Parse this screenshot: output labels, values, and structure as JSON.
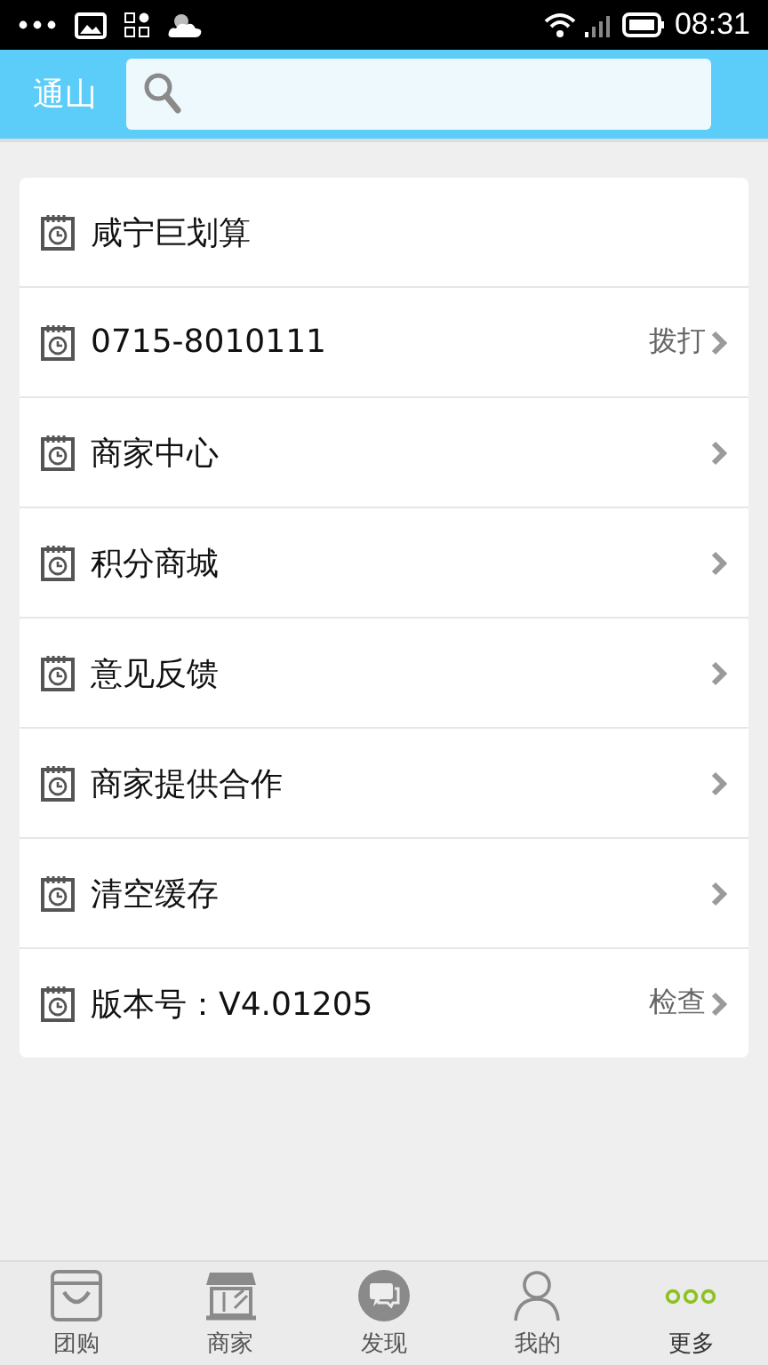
{
  "status_bar": {
    "time": "08:31"
  },
  "header": {
    "city": "通山"
  },
  "menu": [
    {
      "label": "咸宁巨划算",
      "chevron": false
    },
    {
      "label": "0715-8010111",
      "action": "拨打",
      "chevron": true
    },
    {
      "label": "商家中心",
      "chevron": true
    },
    {
      "label": "积分商城",
      "chevron": true
    },
    {
      "label": "意见反馈",
      "chevron": true
    },
    {
      "label": "商家提供合作",
      "chevron": true
    },
    {
      "label": "清空缓存",
      "chevron": true
    },
    {
      "label": "版本号：V4.01205",
      "action": "检查",
      "chevron": true
    }
  ],
  "tabs": [
    {
      "label": "团购",
      "kind": "bag",
      "selected": false
    },
    {
      "label": "商家",
      "kind": "shop",
      "selected": false
    },
    {
      "label": "发现",
      "kind": "chat",
      "selected": false
    },
    {
      "label": "我的",
      "kind": "person",
      "selected": false
    },
    {
      "label": "更多",
      "kind": "more",
      "selected": true
    }
  ]
}
